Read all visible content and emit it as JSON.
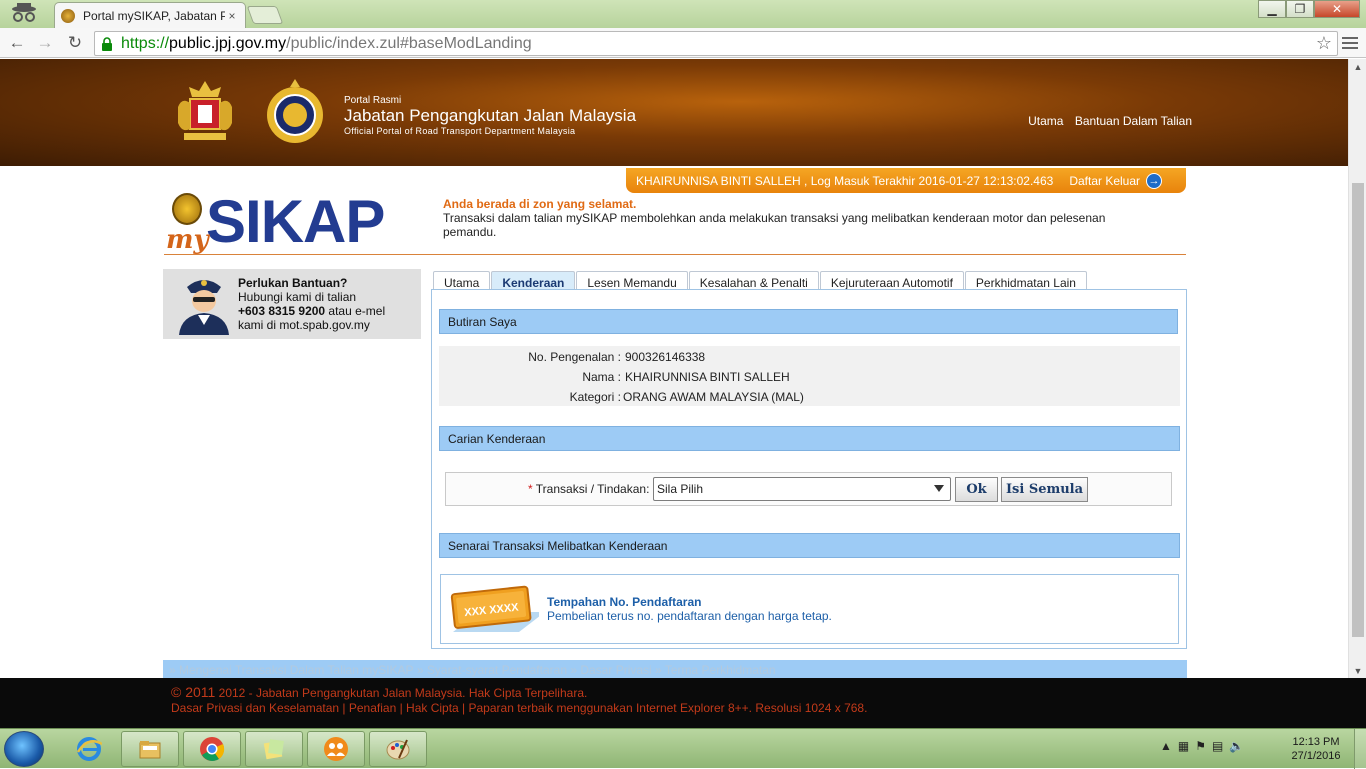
{
  "browser": {
    "tab_title": "Portal mySIKAP, Jabatan P",
    "tab_close": "×",
    "url_scheme": "https://",
    "url_host": "public.jpj.gov.my",
    "url_path": "/public/index.zul#baseModLanding",
    "window_buttons": {
      "minimize": "▁",
      "restore": "❐",
      "close": "✕"
    },
    "star": "☆"
  },
  "header": {
    "portal_label": "Portal Rasmi",
    "agency_name": "Jabatan Pengangkutan Jalan Malaysia",
    "agency_subtitle": "Official Portal of Road Transport Department Malaysia",
    "nav": [
      "Utama",
      "Bantuan Dalam Talian"
    ]
  },
  "userbar": {
    "status": "KHAIRUNNISA BINTI SALLEH , Log Masuk Terakhir 2016-01-27 12:13:02.463",
    "logout_label": "Daftar Keluar",
    "logout_icon": "→"
  },
  "logo": {
    "my": "my",
    "sikap": "SIKAP"
  },
  "notice": {
    "safe_zone": "Anda berada di zon yang selamat.",
    "description": "Transaksi dalam talian mySIKAP membolehkan anda melakukan transaksi yang melibatkan kenderaan motor dan pelesenan pemandu."
  },
  "help": {
    "title": "Perlukan Bantuan?",
    "line1": "Hubungi kami di talian",
    "phone": "+603 8315 9200",
    "line2_suffix": " atau e-mel",
    "line3": "kami di mot.spab.gov.my"
  },
  "tabs": [
    {
      "label": "Utama"
    },
    {
      "label": "Kenderaan"
    },
    {
      "label": "Lesen Memandu"
    },
    {
      "label": "Kesalahan & Penalti"
    },
    {
      "label": "Kejuruteraan Automotif"
    },
    {
      "label": "Perkhidmatan Lain"
    }
  ],
  "butiran": {
    "heading": "Butiran Saya",
    "rows": [
      {
        "key": "No. Pengenalan :",
        "value": "900326146338"
      },
      {
        "key": "Nama :",
        "value": "KHAIRUNNISA BINTI SALLEH"
      },
      {
        "key": "Kategori :",
        "value": "ORANG AWAM MALAYSIA (MAL)"
      }
    ]
  },
  "carian": {
    "heading": "Carian Kenderaan",
    "required_mark": "*",
    "field_label": " Transaksi / Tindakan:",
    "select_value": "Sila Pilih",
    "ok_label": "Ok",
    "reset_label": "Isi Semula"
  },
  "senarai": {
    "heading": "Senarai Transaksi Melibatkan Kenderaan",
    "plate_text": "XXX XXXX",
    "item_title": "Tempahan No. Pendaftaran",
    "item_desc": "Pembelian terus no. pendaftaran dengan harga tetap."
  },
  "footer_links": [
    "» Mengenai Transaksi Dalam Talian mySIKAP",
    "» Syarat-syarat Pendaftaran",
    "» Dasar Privasi",
    "» Terma Perkhidmatan"
  ],
  "footer": {
    "copyright_symbol_year": "© 2011",
    "copyright_rest": " 2012 - Jabatan Pengangkutan Jalan Malaysia. Hak Cipta Terpelihara.",
    "line2": "Dasar Privasi dan Keselamatan | Penafian | Hak Cipta | Paparan terbaik menggunakan Internet Explorer 8++. Resolusi 1024 x 768."
  },
  "taskbar": {
    "time": "12:13 PM",
    "date": "27/1/2016"
  },
  "colors": {
    "header_brown": "#7a3a06",
    "accent_orange": "#e8830c",
    "section_blue": "#9dcbf5",
    "logo_blue": "#233c91",
    "footer_red": "#c23a1a"
  }
}
